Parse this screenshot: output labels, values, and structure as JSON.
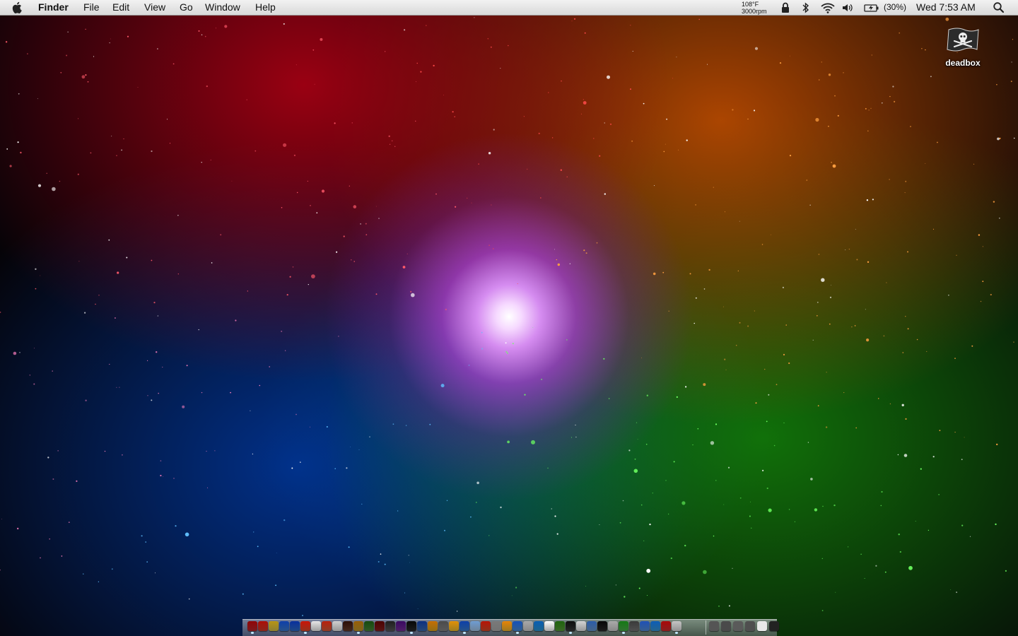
{
  "menubar": {
    "apple_icon": "apple-logo-icon",
    "app_name": "Finder",
    "menus": [
      "File",
      "Edit",
      "View",
      "Go",
      "Window",
      "Help"
    ],
    "temperature": "108°F",
    "fan_speed": "3000rpm",
    "status_icons": [
      "lock-icon",
      "bluetooth-icon",
      "wifi-icon",
      "volume-icon",
      "battery-icon"
    ],
    "battery_text": "(30%)",
    "clock": "Wed 7:53 AM",
    "search_icon": "spotlight-search-icon"
  },
  "desktop": {
    "icons": [
      {
        "label": "deadbox",
        "icon": "pirate-flag-drive-icon"
      }
    ]
  },
  "dock": {
    "app_icon_colors": [
      "#c0282d",
      "#d23b2a",
      "#d8c34a",
      "#3d7fd1",
      "#2f6fc9",
      "#e34b2b",
      "#f2f2f2",
      "#d95c3a",
      "#e6e6e6",
      "#6a3d2a",
      "#c49b2d",
      "#4a8a3b",
      "#8b1f1f",
      "#5a5a5a",
      "#7a2f9e",
      "#2c2c2c",
      "#3b6fb5",
      "#e0a81e",
      "#8a8a8a",
      "#f0c030",
      "#3a80d0",
      "#a8c8e8",
      "#d84a2a",
      "#b0b0b0",
      "#f2b830",
      "#4a90d9",
      "#cfcfcf",
      "#2e9bd6",
      "#ffffff",
      "#5aa03a",
      "#3a3a3a",
      "#e8e8e8",
      "#6a9ad0",
      "#2a2a2a",
      "#d0d0d0",
      "#4ab04a",
      "#7a7a7a",
      "#5890d8",
      "#3a9ad8",
      "#d03030",
      "#e0e0e0"
    ],
    "stack_icon_colors": [
      "#555555",
      "#4a4a4a",
      "#5a5a5a",
      "#4f4f4f",
      "#e8e8e8",
      "#222222"
    ],
    "running_indicator_color": "#bfe6ff"
  }
}
